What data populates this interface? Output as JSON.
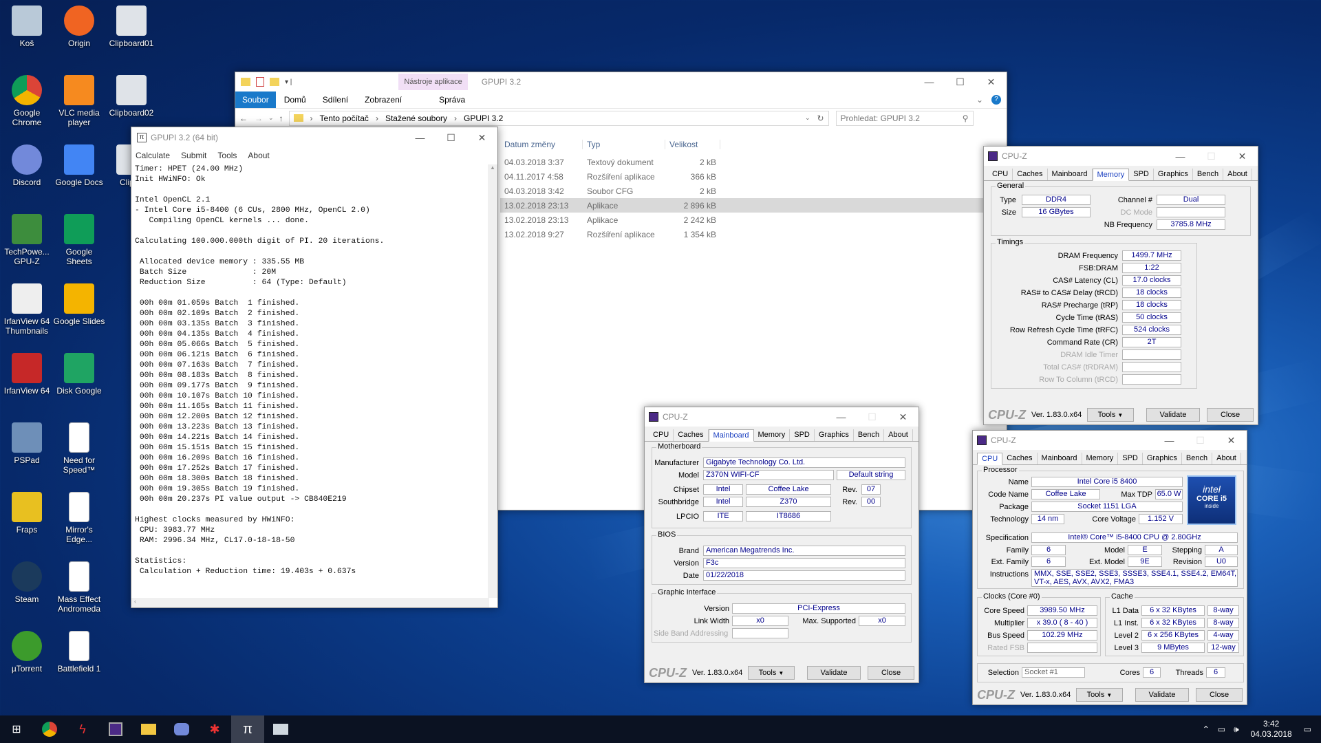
{
  "desktop": {
    "icons": [
      {
        "label": "Koš",
        "icon": "recycle-bin-icon",
        "col": 0,
        "row": 0
      },
      {
        "label": "Origin",
        "icon": "origin-icon",
        "col": 1,
        "row": 0
      },
      {
        "label": "Clipboard01",
        "icon": "image-file-icon",
        "col": 2,
        "row": 0
      },
      {
        "label": "Google Chrome",
        "icon": "chrome-icon",
        "col": 0,
        "row": 1
      },
      {
        "label": "VLC media player",
        "icon": "vlc-icon",
        "col": 1,
        "row": 1
      },
      {
        "label": "Clipboard02",
        "icon": "image-file-icon",
        "col": 2,
        "row": 1
      },
      {
        "label": "Discord",
        "icon": "discord-icon",
        "col": 0,
        "row": 2
      },
      {
        "label": "Google Docs",
        "icon": "google-docs-icon",
        "col": 1,
        "row": 2
      },
      {
        "label": "Clipbo",
        "icon": "image-file-icon",
        "col": 2,
        "row": 2
      },
      {
        "label": "TechPowe... GPU-Z",
        "icon": "gpuz-icon",
        "col": 0,
        "row": 3
      },
      {
        "label": "Google Sheets",
        "icon": "google-sheets-icon",
        "col": 1,
        "row": 3
      },
      {
        "label": "IrfanView 64 Thumbnails",
        "icon": "irfanview-thumbnails-icon",
        "col": 0,
        "row": 4
      },
      {
        "label": "Google Slides",
        "icon": "google-slides-icon",
        "col": 1,
        "row": 4
      },
      {
        "label": "IrfanView 64",
        "icon": "irfanview-icon",
        "col": 0,
        "row": 5
      },
      {
        "label": "Disk Google",
        "icon": "google-drive-icon",
        "col": 1,
        "row": 5
      },
      {
        "label": "PSPad",
        "icon": "pspad-icon",
        "col": 0,
        "row": 6
      },
      {
        "label": "Need for Speed™",
        "icon": "file-icon",
        "col": 1,
        "row": 6
      },
      {
        "label": "Fraps",
        "icon": "fraps-icon",
        "col": 0,
        "row": 7
      },
      {
        "label": "Mirror's Edge...",
        "icon": "file-icon",
        "col": 1,
        "row": 7
      },
      {
        "label": "Steam",
        "icon": "steam-icon",
        "col": 0,
        "row": 8
      },
      {
        "label": "Mass Effect Andromeda",
        "icon": "file-icon",
        "col": 1,
        "row": 8
      },
      {
        "label": "µTorrent",
        "icon": "utorrent-icon",
        "col": 0,
        "row": 9
      },
      {
        "label": "Battlefield 1",
        "icon": "file-icon",
        "col": 1,
        "row": 9
      }
    ]
  },
  "explorer": {
    "title": "GPUPI 3.2",
    "context_tab": "Nástroje aplikace",
    "context_sub": "Správa",
    "tabs": [
      "Soubor",
      "Domů",
      "Sdílení",
      "Zobrazení"
    ],
    "path": [
      "Tento počítač",
      "Stažené soubory",
      "GPUPI 3.2"
    ],
    "search_placeholder": "Prohledat: GPUPI 3.2",
    "columns": {
      "date": "Datum změny",
      "type": "Typ",
      "size": "Velikost"
    },
    "files": [
      {
        "date": "04.03.2018 3:37",
        "type": "Textový dokument",
        "size": "2 kB"
      },
      {
        "date": "04.11.2017 4:58",
        "type": "Rozšíření aplikace",
        "size": "366 kB"
      },
      {
        "date": "04.03.2018 3:42",
        "type": "Soubor CFG",
        "size": "2 kB"
      },
      {
        "date": "13.02.2018 23:13",
        "type": "Aplikace",
        "size": "2 896 kB"
      },
      {
        "date": "13.02.2018 23:13",
        "type": "Aplikace",
        "size": "2 242 kB"
      },
      {
        "date": "13.02.2018 9:27",
        "type": "Rozšíření aplikace",
        "size": "1 354 kB"
      }
    ]
  },
  "gpupi": {
    "title": "GPUPI 3.2 (64 bit)",
    "menu": [
      "Calculate",
      "Submit",
      "Tools",
      "About"
    ],
    "log": "Timer: HPET (24.00 MHz)\nInit HWiNFO: Ok\n\nIntel OpenCL 2.1\n- Intel Core i5-8400 (6 CUs, 2800 MHz, OpenCL 2.0)\n   Compiling OpenCL kernels ... done.\n\nCalculating 100.000.000th digit of PI. 20 iterations.\n\n Allocated device memory : 335.55 MB\n Batch Size              : 20M\n Reduction Size          : 64 (Type: Default)\n\n 00h 00m 01.059s Batch  1 finished.\n 00h 00m 02.109s Batch  2 finished.\n 00h 00m 03.135s Batch  3 finished.\n 00h 00m 04.135s Batch  4 finished.\n 00h 00m 05.066s Batch  5 finished.\n 00h 00m 06.121s Batch  6 finished.\n 00h 00m 07.163s Batch  7 finished.\n 00h 00m 08.183s Batch  8 finished.\n 00h 00m 09.177s Batch  9 finished.\n 00h 00m 10.107s Batch 10 finished.\n 00h 00m 11.165s Batch 11 finished.\n 00h 00m 12.200s Batch 12 finished.\n 00h 00m 13.223s Batch 13 finished.\n 00h 00m 14.221s Batch 14 finished.\n 00h 00m 15.151s Batch 15 finished.\n 00h 00m 16.209s Batch 16 finished.\n 00h 00m 17.252s Batch 17 finished.\n 00h 00m 18.300s Batch 18 finished.\n 00h 00m 19.305s Batch 19 finished.\n 00h 00m 20.237s PI value output -> CB840E219\n\nHighest clocks measured by HWiNFO:\n CPU: 3983.77 MHz\n RAM: 2996.34 MHz, CL17.0-18-18-50\n\nStatistics:\n Calculation + Reduction time: 19.403s + 0.637s"
  },
  "cpuz_common": {
    "title": "CPU-Z",
    "tabs": [
      "CPU",
      "Caches",
      "Mainboard",
      "Memory",
      "SPD",
      "Graphics",
      "Bench",
      "About"
    ],
    "brand": "CPU-Z",
    "version": "Ver. 1.83.0.x64",
    "tools": "Tools",
    "validate": "Validate",
    "close": "Close"
  },
  "cpuz_memory": {
    "general": "General",
    "type_l": "Type",
    "type": "DDR4",
    "size_l": "Size",
    "size": "16 GBytes",
    "channel_l": "Channel #",
    "channel": "Dual",
    "dcmode_l": "DC Mode",
    "nbfreq_l": "NB Frequency",
    "nbfreq": "3785.8 MHz",
    "timings": "Timings",
    "rows": [
      {
        "l": "DRAM Frequency",
        "v": "1499.7 MHz"
      },
      {
        "l": "FSB:DRAM",
        "v": "1:22"
      },
      {
        "l": "CAS# Latency (CL)",
        "v": "17.0 clocks"
      },
      {
        "l": "RAS# to CAS# Delay (tRCD)",
        "v": "18 clocks"
      },
      {
        "l": "RAS# Precharge (tRP)",
        "v": "18 clocks"
      },
      {
        "l": "Cycle Time (tRAS)",
        "v": "50 clocks"
      },
      {
        "l": "Row Refresh Cycle Time (tRFC)",
        "v": "524 clocks"
      },
      {
        "l": "Command Rate (CR)",
        "v": "2T"
      },
      {
        "l": "DRAM Idle Timer",
        "v": ""
      },
      {
        "l": "Total CAS# (tRDRAM)",
        "v": ""
      },
      {
        "l": "Row To Column (tRCD)",
        "v": ""
      }
    ]
  },
  "cpuz_mainboard": {
    "motherboard": "Motherboard",
    "manufacturer_l": "Manufacturer",
    "manufacturer": "Gigabyte Technology Co. Ltd.",
    "model_l": "Model",
    "model": "Z370N WIFI-CF",
    "model2": "Default string",
    "chipset_l": "Chipset",
    "chipset_v": "Intel",
    "chipset_n": "Coffee Lake",
    "rev_l": "Rev.",
    "chipset_rev": "07",
    "south_l": "Southbridge",
    "south_v": "Intel",
    "south_n": "Z370",
    "south_rev": "00",
    "lpcio_l": "LPCIO",
    "lpcio_v": "ITE",
    "lpcio_n": "IT8686",
    "bios": "BIOS",
    "brand_l": "Brand",
    "brand": "American Megatrends Inc.",
    "version_l": "Version",
    "version": "F3c",
    "date_l": "Date",
    "date": "01/22/2018",
    "gi": "Graphic Interface",
    "giv_l": "Version",
    "giv": "PCI-Express",
    "lw_l": "Link Width",
    "lw": "x0",
    "ms_l": "Max. Supported",
    "ms": "x0",
    "sba_l": "Side Band Addressing"
  },
  "cpuz_cpu": {
    "processor": "Processor",
    "name_l": "Name",
    "name": "Intel Core i5 8400",
    "code_l": "Code Name",
    "code": "Coffee Lake",
    "tdp_l": "Max TDP",
    "tdp": "65.0 W",
    "package_l": "Package",
    "package": "Socket 1151 LGA",
    "tech_l": "Technology",
    "tech": "14 nm",
    "cv_l": "Core Voltage",
    "cv": "1.152 V",
    "spec_l": "Specification",
    "spec": "Intel® Core™ i5-8400 CPU @ 2.80GHz",
    "family_l": "Family",
    "family": "6",
    "model_l": "Model",
    "model": "E",
    "stepping_l": "Stepping",
    "stepping": "A",
    "efam_l": "Ext. Family",
    "efam": "6",
    "emodel_l": "Ext. Model",
    "emodel": "9E",
    "rev_l": "Revision",
    "rev": "U0",
    "instr_l": "Instructions",
    "instr": "MMX, SSE, SSE2, SSE3, SSSE3, SSE4.1, SSE4.2, EM64T, VT-x, AES, AVX, AVX2, FMA3",
    "clocks": "Clocks (Core #0)",
    "cs_l": "Core Speed",
    "cs": "3989.50 MHz",
    "mult_l": "Multiplier",
    "mult": "x 39.0 ( 8 - 40 )",
    "bus_l": "Bus Speed",
    "bus": "102.29 MHz",
    "rfsb_l": "Rated FSB",
    "cache": "Cache",
    "l1d_l": "L1 Data",
    "l1d": "6 x 32 KBytes",
    "l1d_w": "8-way",
    "l1i_l": "L1 Inst.",
    "l1i": "6 x 32 KBytes",
    "l1i_w": "8-way",
    "l2_l": "Level 2",
    "l2": "6 x 256 KBytes",
    "l2_w": "4-way",
    "l3_l": "Level 3",
    "l3": "9 MBytes",
    "l3_w": "12-way",
    "sel_l": "Selection",
    "sel": "Socket #1",
    "cores_l": "Cores",
    "cores": "6",
    "threads_l": "Threads",
    "threads": "6",
    "badge_top": "intel",
    "badge_mid": "CORE i5",
    "badge_bot": "inside"
  },
  "taskbar": {
    "time": "3:42",
    "date": "04.03.2018"
  }
}
